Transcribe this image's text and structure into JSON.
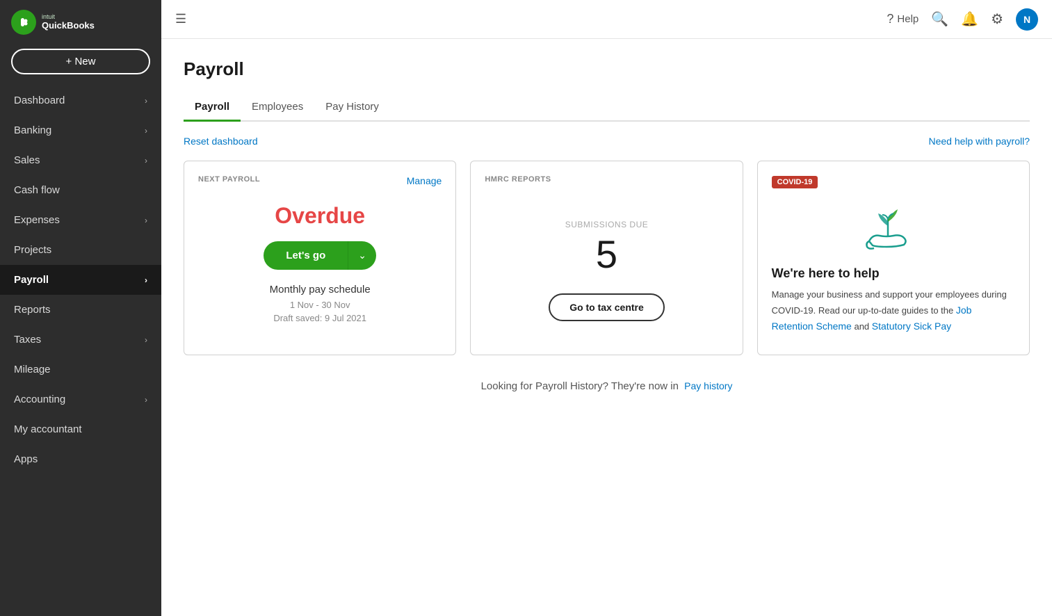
{
  "sidebar": {
    "logo": {
      "intuit": "intuit",
      "quickbooks": "QuickBooks"
    },
    "new_button": "+ New",
    "nav_items": [
      {
        "id": "dashboard",
        "label": "Dashboard",
        "has_chevron": true,
        "active": false
      },
      {
        "id": "banking",
        "label": "Banking",
        "has_chevron": true,
        "active": false
      },
      {
        "id": "sales",
        "label": "Sales",
        "has_chevron": true,
        "active": false
      },
      {
        "id": "cashflow",
        "label": "Cash flow",
        "has_chevron": false,
        "active": false
      },
      {
        "id": "expenses",
        "label": "Expenses",
        "has_chevron": true,
        "active": false
      },
      {
        "id": "projects",
        "label": "Projects",
        "has_chevron": false,
        "active": false
      },
      {
        "id": "payroll",
        "label": "Payroll",
        "has_chevron": true,
        "active": true
      },
      {
        "id": "reports",
        "label": "Reports",
        "has_chevron": false,
        "active": false
      },
      {
        "id": "taxes",
        "label": "Taxes",
        "has_chevron": true,
        "active": false
      },
      {
        "id": "mileage",
        "label": "Mileage",
        "has_chevron": false,
        "active": false
      },
      {
        "id": "accounting",
        "label": "Accounting",
        "has_chevron": true,
        "active": false
      },
      {
        "id": "my-accountant",
        "label": "My accountant",
        "has_chevron": false,
        "active": false
      },
      {
        "id": "apps",
        "label": "Apps",
        "has_chevron": false,
        "active": false
      }
    ]
  },
  "topbar": {
    "help_label": "Help",
    "user_initial": "N"
  },
  "page": {
    "title": "Payroll",
    "tabs": [
      {
        "id": "payroll",
        "label": "Payroll",
        "active": true
      },
      {
        "id": "employees",
        "label": "Employees",
        "active": false
      },
      {
        "id": "pay-history",
        "label": "Pay History",
        "active": false
      }
    ],
    "reset_dashboard": "Reset dashboard",
    "need_help": "Need help with payroll?",
    "cards": {
      "next_payroll": {
        "label": "NEXT PAYROLL",
        "manage_link": "Manage",
        "overdue": "Overdue",
        "lets_go": "Let's go",
        "schedule": "Monthly pay schedule",
        "date_range": "1 Nov - 30 Nov",
        "draft_saved": "Draft saved: 9 Jul 2021"
      },
      "hmrc_reports": {
        "label": "HMRC REPORTS",
        "submissions_label": "SUBMISSIONS DUE",
        "submissions_count": "5",
        "button": "Go to tax centre"
      },
      "covid": {
        "badge": "COVID-19",
        "title": "We're here to help",
        "body_text": "Manage your business and support your employees during COVID-19. Read our up-to-date guides to the",
        "link1": "Job Retention Scheme",
        "link_middle": "and",
        "link2": "Statutory Sick Pay"
      }
    },
    "pay_history_note": "Looking for Payroll History? They're now in",
    "pay_history_link": "Pay history"
  }
}
